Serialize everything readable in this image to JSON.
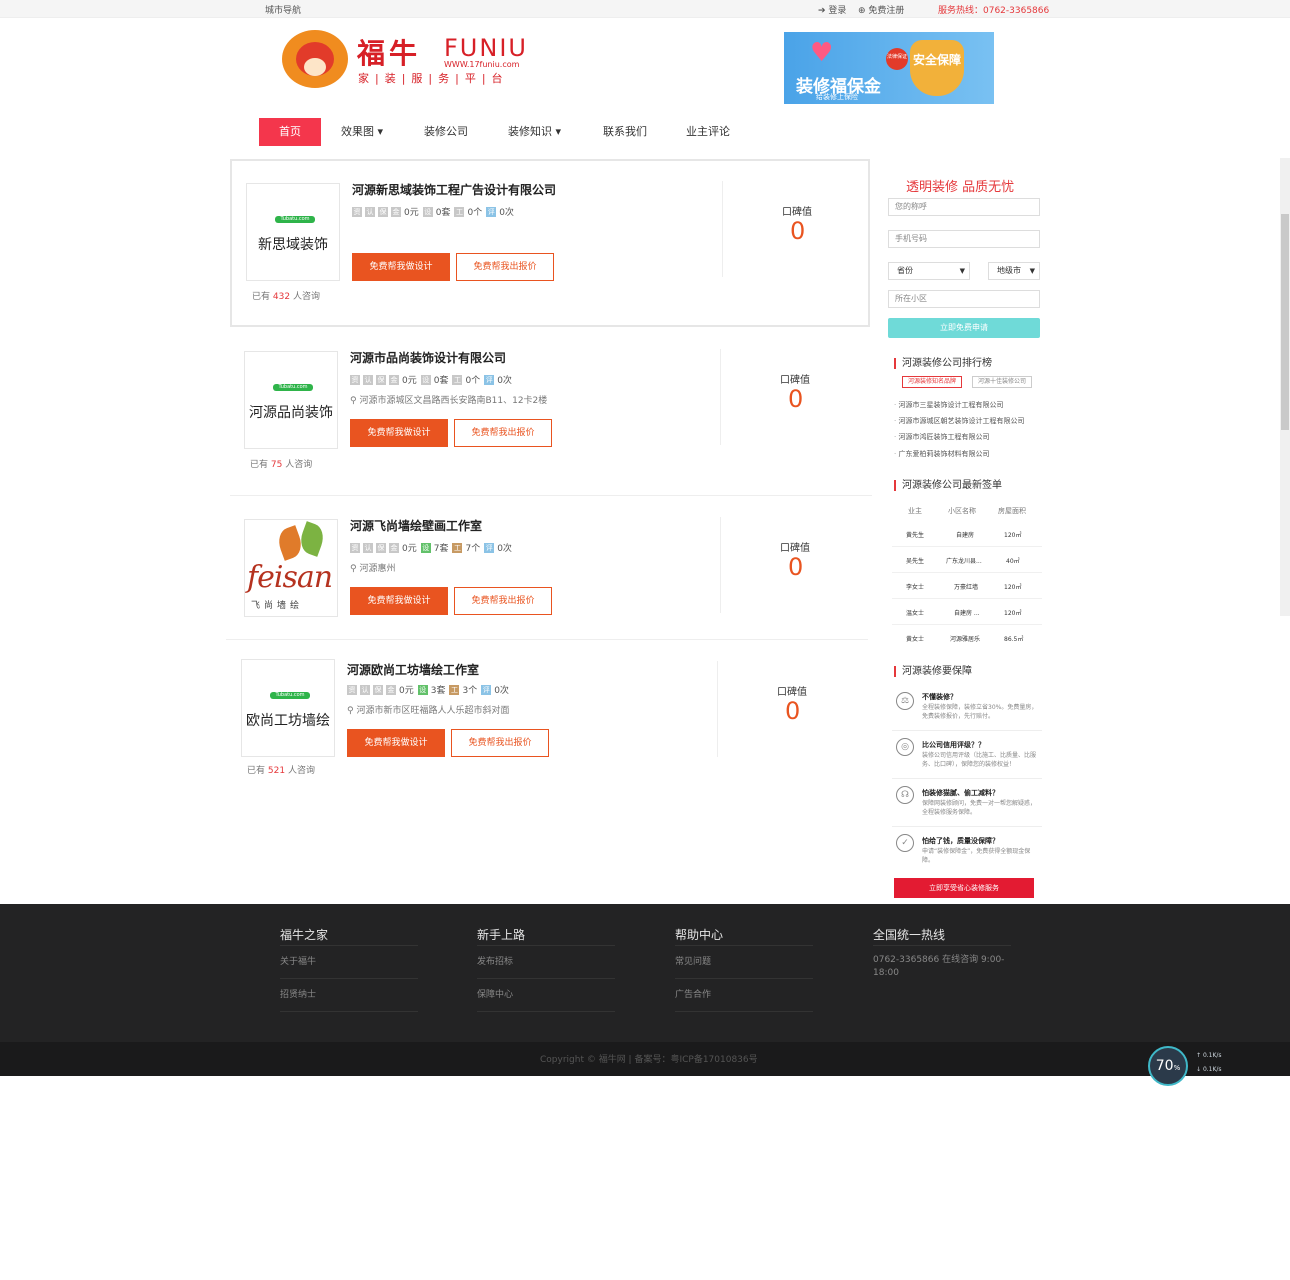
{
  "topbar": {
    "city_nav": "城市导航",
    "login": "登录",
    "register": "免费注册",
    "hotline": "服务热线：0762-3365866"
  },
  "logo": {
    "cn": "福牛",
    "en": "FUNIU",
    "url": "WWW.17funiu.com",
    "slogan": "家|装|服|务|平|台"
  },
  "banner": {
    "title": "装修福保金",
    "subtitle": "给装修上保险",
    "shield": "安全保障",
    "badge": "法律保证"
  },
  "nav": [
    "首页",
    "效果图",
    "装修公司",
    "装修知识",
    "联系我们",
    "业主评论"
  ],
  "companies": [
    {
      "name": "河源新思域装饰工程广告设计有限公司",
      "logo_text": "新思域装饰",
      "logo_tag": "Tubatu.com",
      "stats": [
        "0元",
        "0套",
        "0个",
        "0次"
      ],
      "address": "",
      "consult_pre": "已有",
      "consult_num": "432",
      "consult_post": "人咨询",
      "btn_design": "免费帮我做设计",
      "btn_quote": "免费帮我出报价",
      "rep_label": "口碑值",
      "rep_value": "0"
    },
    {
      "name": "河源市品尚装饰设计有限公司",
      "logo_text": "河源品尚装饰",
      "logo_tag": "Tubatu.com",
      "stats": [
        "0元",
        "0套",
        "0个",
        "0次"
      ],
      "address": "河源市源城区文昌路西长安路南B11、12卡2楼",
      "consult_pre": "已有",
      "consult_num": "75",
      "consult_post": "人咨询",
      "btn_design": "免费帮我做设计",
      "btn_quote": "免费帮我出报价",
      "rep_label": "口碑值",
      "rep_value": "0"
    },
    {
      "name": "河源飞尚墙绘壁画工作室",
      "logo_text": "feisan",
      "logo_sub": "飞尚墙绘",
      "stats": [
        "0元",
        "7套",
        "7个",
        "0次"
      ],
      "address": "河源惠州",
      "btn_design": "免费帮我做设计",
      "btn_quote": "免费帮我出报价",
      "rep_label": "口碑值",
      "rep_value": "0"
    },
    {
      "name": "河源欧尚工坊墙绘工作室",
      "logo_text": "欧尚工坊墙绘",
      "logo_tag": "Tubatu.com",
      "stats": [
        "0元",
        "3套",
        "3个",
        "0次"
      ],
      "address": "河源市新市区旺福路人人乐超市斜对面",
      "consult_pre": "已有",
      "consult_num": "521",
      "consult_post": "人咨询",
      "btn_design": "免费帮我做设计",
      "btn_quote": "免费帮我出报价",
      "rep_label": "口碑值",
      "rep_value": "0"
    }
  ],
  "stat_icons": [
    "资",
    "认",
    "保",
    "金",
    "设",
    "工",
    "评"
  ],
  "form": {
    "title": "透明装修 品质无忧",
    "name_placeholder": "您的称呼",
    "phone_placeholder": "手机号码",
    "province": "省份",
    "city": "地级市",
    "community_placeholder": "所在小区",
    "submit": "立即免费申请"
  },
  "rank": {
    "title": "河源装修公司排行榜",
    "tab1": "河源装修知名品牌",
    "tab2": "河源十佳装修公司",
    "items": [
      "河源市三星装饰设计工程有限公司",
      "河源市源城区朝艺装饰设计工程有限公司",
      "河源市鸿匠装饰工程有限公司",
      "广东爱柏莉装饰材料有限公司"
    ]
  },
  "orders": {
    "title": "河源装修公司最新签单",
    "headers": [
      "业主",
      "小区名称",
      "房屋面积"
    ],
    "rows": [
      [
        "黄先生",
        "自建房",
        "120㎡"
      ],
      [
        "吴先生",
        "广东龙川县...",
        "40㎡"
      ],
      [
        "李女士",
        "万豪红墙",
        "120㎡"
      ],
      [
        "温女士",
        "自建房 ...",
        "120㎡"
      ],
      [
        "黄女士",
        "河源雅居乐",
        "86.5㎡"
      ]
    ]
  },
  "guarantee": {
    "title": "河源装修要保障",
    "items": [
      {
        "t": "不懂装修？",
        "d": "全程装修保障，装修立省30%。免费量房，免费装修报价，先行赔付。"
      },
      {
        "t": "比公司信用评级？？",
        "d": "装修公司信用评级（比施工、比质量、比服务、比口碑），保障您的装修权益！"
      },
      {
        "t": "怕装修猫腻、偷工减料？",
        "d": "保障网装修顾问，免费一对一帮您解疑惑，全程装修服务保障。"
      },
      {
        "t": "怕给了钱，质量没保障？",
        "d": "申请“装修保障金”，免费获得全额现金保障。"
      }
    ],
    "button": "立即享受省心装修服务"
  },
  "footer": {
    "cols": [
      {
        "title": "福牛之家",
        "links": [
          "关于福牛",
          "招贤纳士"
        ]
      },
      {
        "title": "新手上路",
        "links": [
          "发布招标",
          "保障中心"
        ]
      },
      {
        "title": "帮助中心",
        "links": [
          "常见问题",
          "广告合作"
        ]
      },
      {
        "title": "全国统一热线",
        "links": [
          "0762-3365866 在线咨询 9:00-18:00"
        ]
      }
    ],
    "copyright": "Copyright © 福牛网 | 备案号：粤ICP备17010836号"
  },
  "speed": {
    "percent": "70",
    "up": "0.1K/s",
    "down": "0.1K/s"
  }
}
